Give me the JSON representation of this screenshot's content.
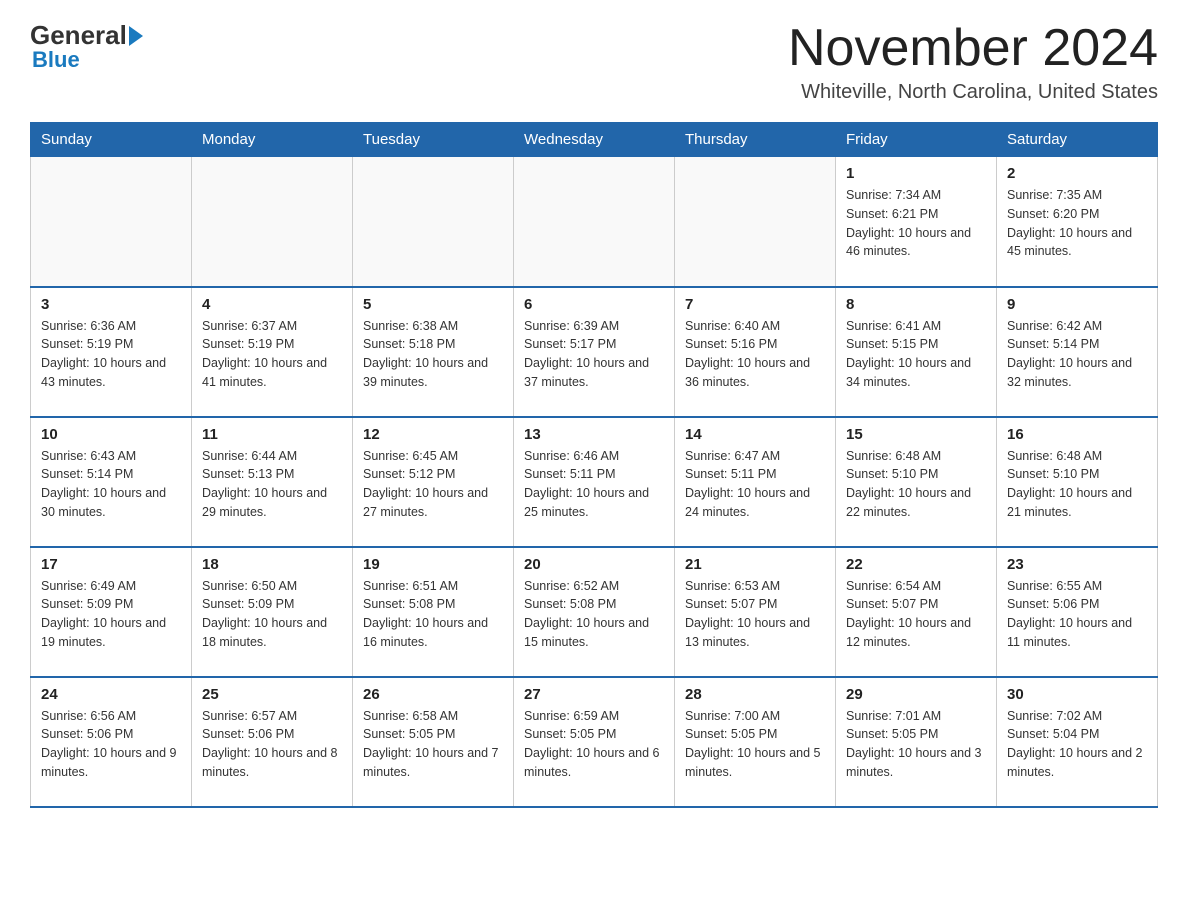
{
  "logo": {
    "general": "General",
    "blue": "Blue"
  },
  "title": "November 2024",
  "location": "Whiteville, North Carolina, United States",
  "days_of_week": [
    "Sunday",
    "Monday",
    "Tuesday",
    "Wednesday",
    "Thursday",
    "Friday",
    "Saturday"
  ],
  "weeks": [
    [
      {
        "day": "",
        "info": ""
      },
      {
        "day": "",
        "info": ""
      },
      {
        "day": "",
        "info": ""
      },
      {
        "day": "",
        "info": ""
      },
      {
        "day": "",
        "info": ""
      },
      {
        "day": "1",
        "info": "Sunrise: 7:34 AM\nSunset: 6:21 PM\nDaylight: 10 hours and 46 minutes."
      },
      {
        "day": "2",
        "info": "Sunrise: 7:35 AM\nSunset: 6:20 PM\nDaylight: 10 hours and 45 minutes."
      }
    ],
    [
      {
        "day": "3",
        "info": "Sunrise: 6:36 AM\nSunset: 5:19 PM\nDaylight: 10 hours and 43 minutes."
      },
      {
        "day": "4",
        "info": "Sunrise: 6:37 AM\nSunset: 5:19 PM\nDaylight: 10 hours and 41 minutes."
      },
      {
        "day": "5",
        "info": "Sunrise: 6:38 AM\nSunset: 5:18 PM\nDaylight: 10 hours and 39 minutes."
      },
      {
        "day": "6",
        "info": "Sunrise: 6:39 AM\nSunset: 5:17 PM\nDaylight: 10 hours and 37 minutes."
      },
      {
        "day": "7",
        "info": "Sunrise: 6:40 AM\nSunset: 5:16 PM\nDaylight: 10 hours and 36 minutes."
      },
      {
        "day": "8",
        "info": "Sunrise: 6:41 AM\nSunset: 5:15 PM\nDaylight: 10 hours and 34 minutes."
      },
      {
        "day": "9",
        "info": "Sunrise: 6:42 AM\nSunset: 5:14 PM\nDaylight: 10 hours and 32 minutes."
      }
    ],
    [
      {
        "day": "10",
        "info": "Sunrise: 6:43 AM\nSunset: 5:14 PM\nDaylight: 10 hours and 30 minutes."
      },
      {
        "day": "11",
        "info": "Sunrise: 6:44 AM\nSunset: 5:13 PM\nDaylight: 10 hours and 29 minutes."
      },
      {
        "day": "12",
        "info": "Sunrise: 6:45 AM\nSunset: 5:12 PM\nDaylight: 10 hours and 27 minutes."
      },
      {
        "day": "13",
        "info": "Sunrise: 6:46 AM\nSunset: 5:11 PM\nDaylight: 10 hours and 25 minutes."
      },
      {
        "day": "14",
        "info": "Sunrise: 6:47 AM\nSunset: 5:11 PM\nDaylight: 10 hours and 24 minutes."
      },
      {
        "day": "15",
        "info": "Sunrise: 6:48 AM\nSunset: 5:10 PM\nDaylight: 10 hours and 22 minutes."
      },
      {
        "day": "16",
        "info": "Sunrise: 6:48 AM\nSunset: 5:10 PM\nDaylight: 10 hours and 21 minutes."
      }
    ],
    [
      {
        "day": "17",
        "info": "Sunrise: 6:49 AM\nSunset: 5:09 PM\nDaylight: 10 hours and 19 minutes."
      },
      {
        "day": "18",
        "info": "Sunrise: 6:50 AM\nSunset: 5:09 PM\nDaylight: 10 hours and 18 minutes."
      },
      {
        "day": "19",
        "info": "Sunrise: 6:51 AM\nSunset: 5:08 PM\nDaylight: 10 hours and 16 minutes."
      },
      {
        "day": "20",
        "info": "Sunrise: 6:52 AM\nSunset: 5:08 PM\nDaylight: 10 hours and 15 minutes."
      },
      {
        "day": "21",
        "info": "Sunrise: 6:53 AM\nSunset: 5:07 PM\nDaylight: 10 hours and 13 minutes."
      },
      {
        "day": "22",
        "info": "Sunrise: 6:54 AM\nSunset: 5:07 PM\nDaylight: 10 hours and 12 minutes."
      },
      {
        "day": "23",
        "info": "Sunrise: 6:55 AM\nSunset: 5:06 PM\nDaylight: 10 hours and 11 minutes."
      }
    ],
    [
      {
        "day": "24",
        "info": "Sunrise: 6:56 AM\nSunset: 5:06 PM\nDaylight: 10 hours and 9 minutes."
      },
      {
        "day": "25",
        "info": "Sunrise: 6:57 AM\nSunset: 5:06 PM\nDaylight: 10 hours and 8 minutes."
      },
      {
        "day": "26",
        "info": "Sunrise: 6:58 AM\nSunset: 5:05 PM\nDaylight: 10 hours and 7 minutes."
      },
      {
        "day": "27",
        "info": "Sunrise: 6:59 AM\nSunset: 5:05 PM\nDaylight: 10 hours and 6 minutes."
      },
      {
        "day": "28",
        "info": "Sunrise: 7:00 AM\nSunset: 5:05 PM\nDaylight: 10 hours and 5 minutes."
      },
      {
        "day": "29",
        "info": "Sunrise: 7:01 AM\nSunset: 5:05 PM\nDaylight: 10 hours and 3 minutes."
      },
      {
        "day": "30",
        "info": "Sunrise: 7:02 AM\nSunset: 5:04 PM\nDaylight: 10 hours and 2 minutes."
      }
    ]
  ]
}
